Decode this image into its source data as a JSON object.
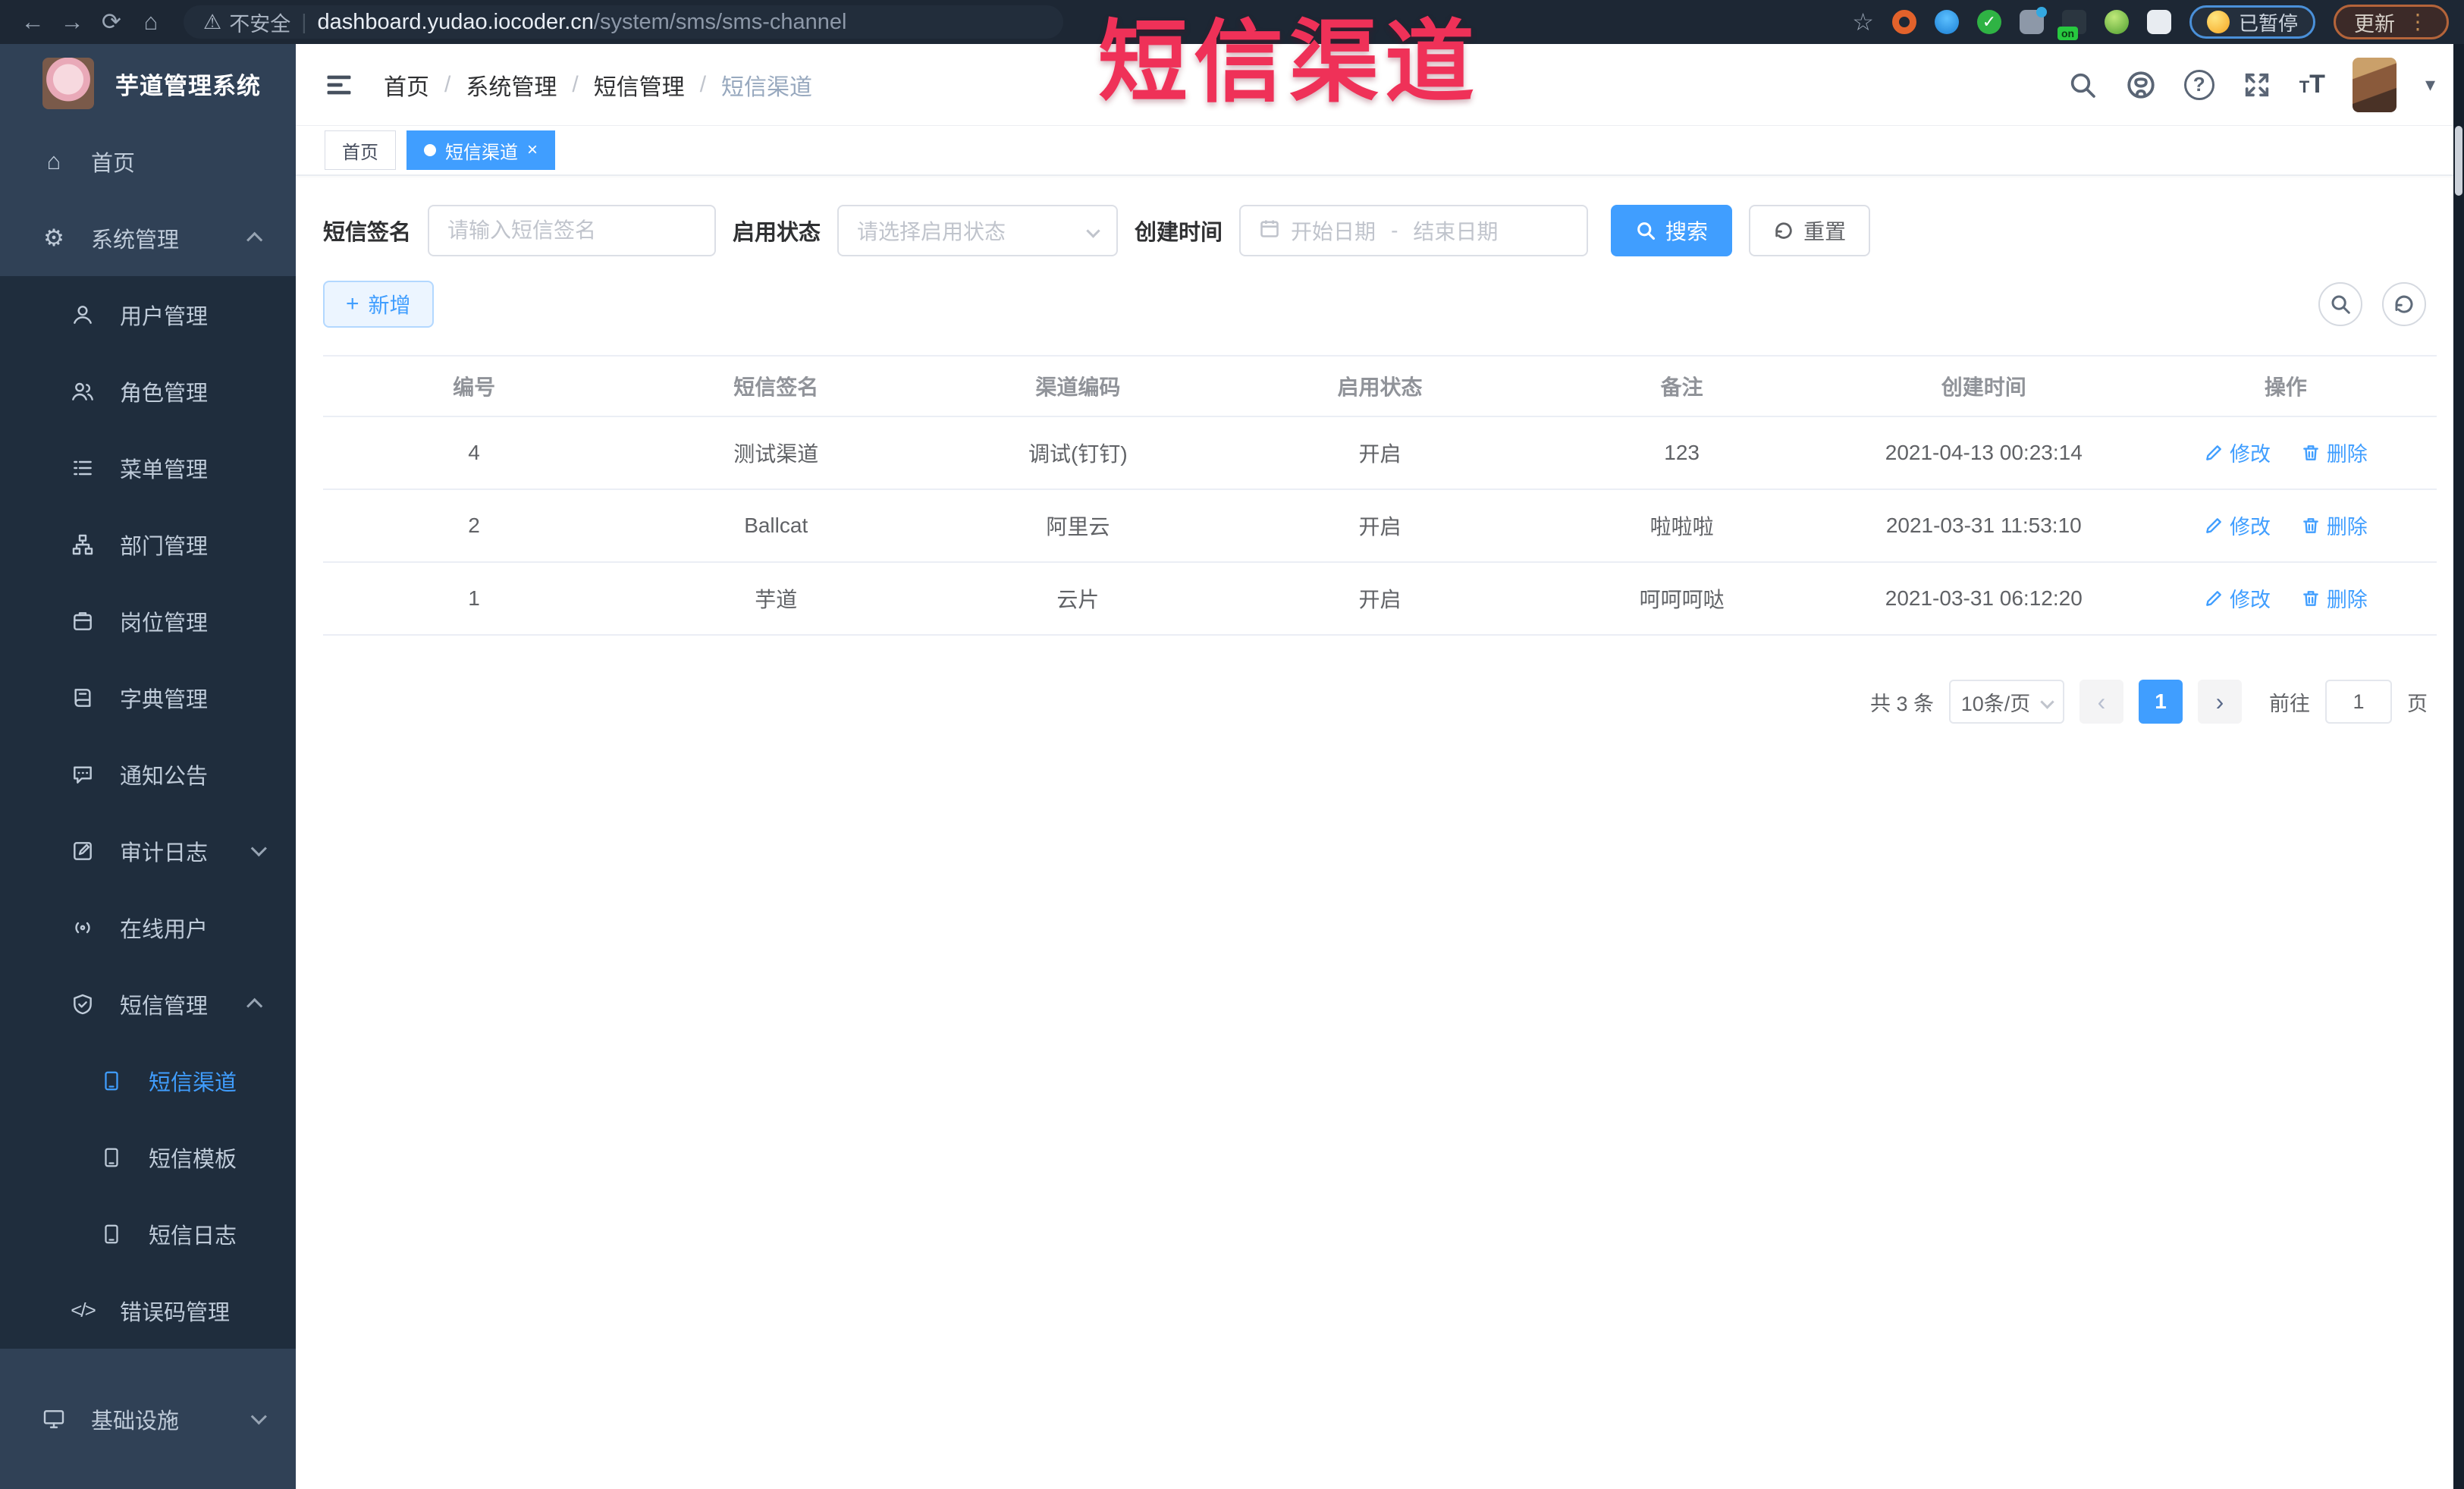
{
  "browser": {
    "security_label": "不安全",
    "url_host": "dashboard.yudao.iocoder.cn",
    "url_path": "/system/sms/sms-channel",
    "paused_label": "已暂停",
    "update_label": "更新",
    "menu_dots": "⋮"
  },
  "overlay": {
    "title": "短信渠道"
  },
  "icons": {
    "back": "←",
    "forward": "→",
    "reload": "⟳",
    "home": "⌂",
    "warning": "⚠",
    "star": "☆",
    "divider": "|",
    "home_menu": "⌂",
    "gear": "⚙",
    "code": "</>",
    "caret_down": "▾",
    "check": "✓",
    "close": "×",
    "plus": "+",
    "prev": "‹",
    "next": "›"
  },
  "sidebar": {
    "logo_title": "芋道管理系统",
    "items": [
      {
        "label": "首页"
      },
      {
        "label": "系统管理"
      },
      {
        "label": "用户管理"
      },
      {
        "label": "角色管理"
      },
      {
        "label": "菜单管理"
      },
      {
        "label": "部门管理"
      },
      {
        "label": "岗位管理"
      },
      {
        "label": "字典管理"
      },
      {
        "label": "通知公告"
      },
      {
        "label": "审计日志"
      },
      {
        "label": "在线用户"
      },
      {
        "label": "短信管理"
      },
      {
        "label": "短信渠道"
      },
      {
        "label": "短信模板"
      },
      {
        "label": "短信日志"
      },
      {
        "label": "错误码管理"
      },
      {
        "label": "基础设施"
      }
    ]
  },
  "header": {
    "breadcrumb": [
      "首页",
      "系统管理",
      "短信管理",
      "短信渠道"
    ],
    "font_icon_big": "T",
    "font_icon_small": "T"
  },
  "tags": [
    {
      "label": "首页"
    },
    {
      "label": "短信渠道"
    }
  ],
  "filters": {
    "signature_label": "短信签名",
    "signature_placeholder": "请输入短信签名",
    "status_label": "启用状态",
    "status_placeholder": "请选择启用状态",
    "time_label": "创建时间",
    "date_start_placeholder": "开始日期",
    "date_separator": "-",
    "date_end_placeholder": "结束日期",
    "search_label": "搜索",
    "reset_label": "重置"
  },
  "toolbar": {
    "add_label": "新增"
  },
  "table": {
    "headers": [
      "编号",
      "短信签名",
      "渠道编码",
      "启用状态",
      "备注",
      "创建时间",
      "操作"
    ],
    "actions": {
      "edit": "修改",
      "delete": "删除"
    },
    "rows": [
      {
        "id": "4",
        "signature": "测试渠道",
        "code": "调试(钉钉)",
        "status": "开启",
        "remark": "123",
        "created": "2021-04-13 00:23:14"
      },
      {
        "id": "2",
        "signature": "Ballcat",
        "code": "阿里云",
        "status": "开启",
        "remark": "啦啦啦",
        "created": "2021-03-31 11:53:10"
      },
      {
        "id": "1",
        "signature": "芋道",
        "code": "云片",
        "status": "开启",
        "remark": "呵呵呵哒",
        "created": "2021-03-31 06:12:20"
      }
    ]
  },
  "pagination": {
    "total": "共 3 条",
    "page_size": "10条/页",
    "current": "1",
    "goto_label": "前往",
    "goto_value": "1",
    "page_unit": "页"
  },
  "colors": {
    "primary": "#409EFF",
    "overlay_red": "#ef3158",
    "sidebar_bg": "#304156",
    "submenu_bg": "#1f2d3d"
  }
}
